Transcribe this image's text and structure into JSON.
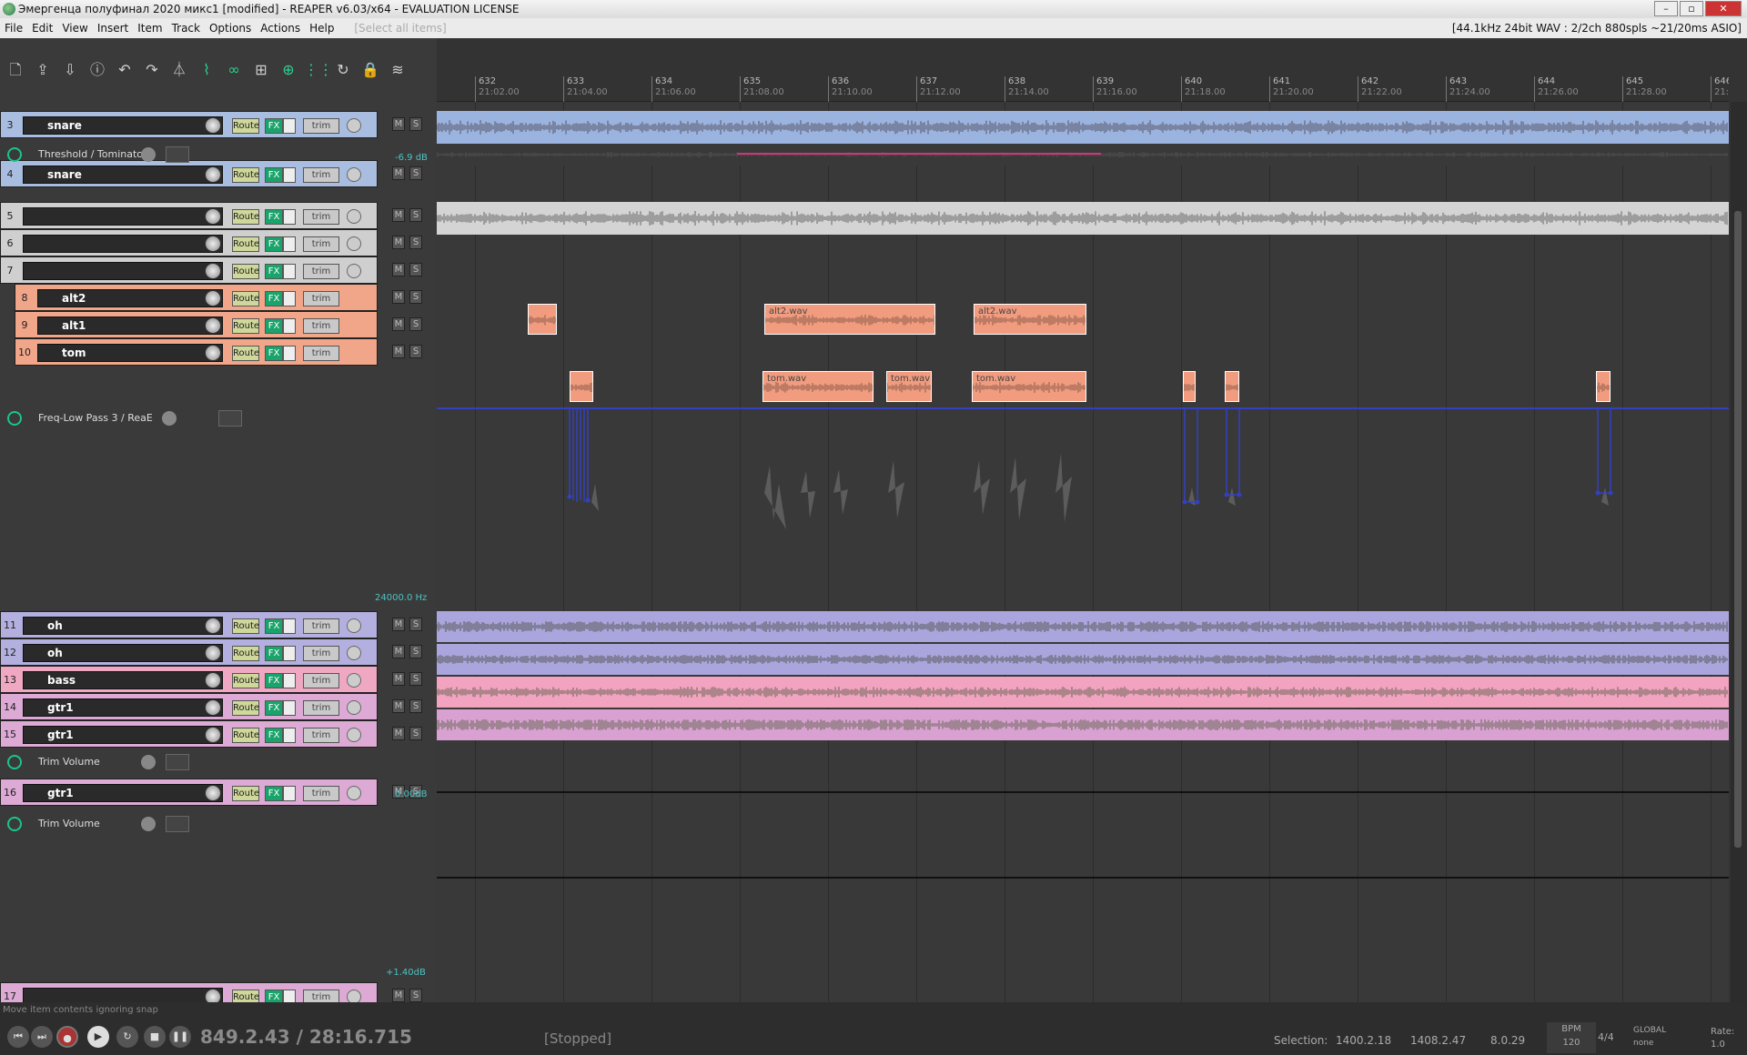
{
  "window": {
    "title": "Эмергенца полуфинал 2020 микс1 [modified] - REAPER v6.03/x64 - EVALUATION LICENSE",
    "controls": [
      "–",
      "▫",
      "✕"
    ]
  },
  "menu": {
    "items": [
      "File",
      "Edit",
      "View",
      "Insert",
      "Item",
      "Track",
      "Options",
      "Actions",
      "Help"
    ],
    "select_all": "[Select all items]",
    "audio_info": "[44.1kHz 24bit WAV : 2/2ch 880spls ~21/20ms ASIO]"
  },
  "toolbar": {
    "icons": [
      "new-project-icon",
      "open-icon",
      "save-icon",
      "info-icon",
      "undo-icon",
      "redo-icon",
      "metronome-icon",
      "ripple-icon",
      "link-icon",
      "grid-icon",
      "snap-icon",
      "grid-lines-icon",
      "loop-icon",
      "lock-icon",
      "envelope-icon"
    ]
  },
  "ruler": {
    "marks": [
      {
        "bar": "632",
        "time": "21:02.00"
      },
      {
        "bar": "633",
        "time": "21:04.00"
      },
      {
        "bar": "634",
        "time": "21:06.00"
      },
      {
        "bar": "635",
        "time": "21:08.00"
      },
      {
        "bar": "636",
        "time": "21:10.00"
      },
      {
        "bar": "637",
        "time": "21:12.00"
      },
      {
        "bar": "638",
        "time": "21:14.00"
      },
      {
        "bar": "639",
        "time": "21:16.00"
      },
      {
        "bar": "640",
        "time": "21:18.00"
      },
      {
        "bar": "641",
        "time": "21:20.00"
      },
      {
        "bar": "642",
        "time": "21:22.00"
      },
      {
        "bar": "643",
        "time": "21:24.00"
      },
      {
        "bar": "644",
        "time": "21:26.00"
      },
      {
        "bar": "645",
        "time": "21:28.00"
      },
      {
        "bar": "646",
        "time": "21:30.00"
      }
    ]
  },
  "track_labels": {
    "route": "Route",
    "fx": "FX",
    "trim": "trim",
    "mute": "M",
    "solo": "S"
  },
  "tracks": [
    {
      "num": "3",
      "name": "snare",
      "color": "#a9bde0"
    },
    {
      "num": "4",
      "name": "snare",
      "color": "#a9bde0"
    },
    {
      "num": "5",
      "name": "",
      "color": "#cfcfcf"
    },
    {
      "num": "6",
      "name": "",
      "color": "#cfcfcf"
    },
    {
      "num": "7",
      "name": "",
      "color": "#cfcfcf"
    },
    {
      "num": "8",
      "name": "alt2",
      "color": "#f1a68a"
    },
    {
      "num": "9",
      "name": "alt1",
      "color": "#f1a68a"
    },
    {
      "num": "10",
      "name": "tom",
      "color": "#f1a68a"
    },
    {
      "num": "11",
      "name": "oh",
      "color": "#b3b0df"
    },
    {
      "num": "12",
      "name": "oh",
      "color": "#b3b0df"
    },
    {
      "num": "13",
      "name": "bass",
      "color": "#f0a8c2"
    },
    {
      "num": "14",
      "name": "gtr1",
      "color": "#dcaad4"
    },
    {
      "num": "15",
      "name": "gtr1",
      "color": "#dcaad4"
    },
    {
      "num": "16",
      "name": "gtr1",
      "color": "#dcaad4"
    },
    {
      "num": "17",
      "name": "",
      "color": "#dcaad4"
    }
  ],
  "envelopes": [
    {
      "name": "Threshold / Tominator",
      "value": "-6.9 dB"
    },
    {
      "name": "Freq-Low Pass 3 / ReaE",
      "value": "24000.0 Hz"
    },
    {
      "name": "Trim Volume",
      "value": "0.00dB"
    },
    {
      "name": "Trim Volume",
      "value": "+1.40dB"
    }
  ],
  "items": {
    "alt2": "alt2.wav",
    "tom": "tom.wav"
  },
  "transport": {
    "status_hint": "Move item contents ignoring snap",
    "position": "849.2.43 / 28:16.715",
    "state": "[Stopped]",
    "selection_label": "Selection:",
    "sel_start": "1400.2.18",
    "sel_end": "1408.2.47",
    "sel_len": "8.0.29",
    "bpm_label": "BPM",
    "bpm": "120",
    "time_sig": "4/4",
    "global_label": "GLOBAL",
    "global_value": "none",
    "rate_label": "Rate:",
    "rate": "1.0"
  }
}
